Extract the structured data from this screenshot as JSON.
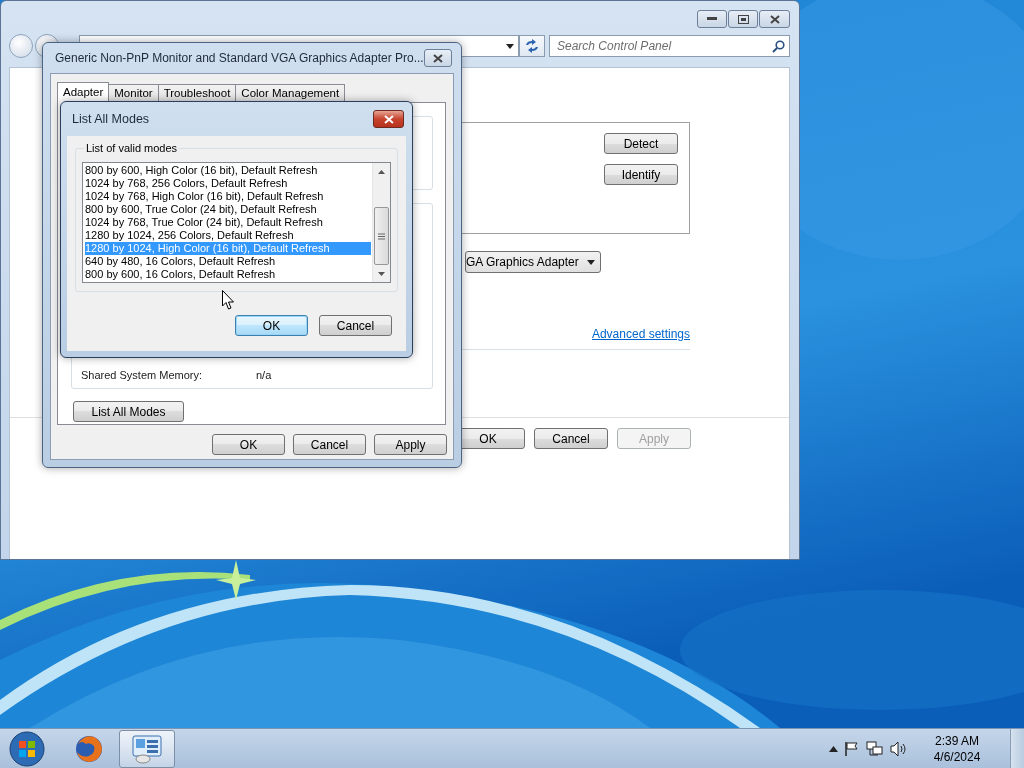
{
  "main_window": {
    "search": {
      "placeholder": "Search Control Panel"
    },
    "side_buttons": [
      {
        "label": "Detect"
      },
      {
        "label": "Identify"
      }
    ],
    "adapter_dropdown": {
      "value": "GA Graphics Adapter"
    },
    "link": "Advanced settings",
    "buttons": [
      {
        "label": "OK",
        "disabled": false
      },
      {
        "label": "Cancel",
        "disabled": false
      },
      {
        "label": "Apply",
        "disabled": true
      }
    ]
  },
  "properties_dialog": {
    "title": "Generic Non-PnP Monitor and Standard VGA Graphics Adapter Pro...",
    "tabs": [
      {
        "label": "Adapter",
        "selected": true
      },
      {
        "label": "Monitor",
        "selected": false
      },
      {
        "label": "Troubleshoot",
        "selected": false
      },
      {
        "label": "Color Management",
        "selected": false
      }
    ],
    "memory": {
      "label": "Shared System Memory:",
      "value": "n/a"
    },
    "list_all_modes_button": "List All Modes",
    "buttons": [
      {
        "label": "OK",
        "disabled": false
      },
      {
        "label": "Cancel",
        "disabled": false
      },
      {
        "label": "Apply",
        "disabled": false
      }
    ]
  },
  "modes_dialog": {
    "title": "List All Modes",
    "group_label": "List of valid modes",
    "modes": [
      {
        "label": "800 by 600, High Color (16 bit), Default Refresh",
        "selected": false
      },
      {
        "label": "1024 by 768, 256 Colors, Default Refresh",
        "selected": false
      },
      {
        "label": "1024 by 768, High Color (16 bit), Default Refresh",
        "selected": false
      },
      {
        "label": "800 by 600, True Color (24 bit), Default Refresh",
        "selected": false
      },
      {
        "label": "1024 by 768, True Color (24 bit), Default Refresh",
        "selected": false
      },
      {
        "label": "1280 by 1024, 256 Colors, Default Refresh",
        "selected": false
      },
      {
        "label": "1280 by 1024, High Color (16 bit), Default Refresh",
        "selected": true
      },
      {
        "label": "640 by 480, 16 Colors, Default Refresh",
        "selected": false
      },
      {
        "label": "800 by 600, 16 Colors, Default Refresh",
        "selected": false
      }
    ],
    "buttons": [
      {
        "label": "OK",
        "default": true
      },
      {
        "label": "Cancel",
        "default": false
      }
    ]
  },
  "taskbar": {
    "apps": [
      {
        "kind": "browser",
        "active": false
      },
      {
        "kind": "control-panel",
        "active": true
      }
    ],
    "clock": {
      "time": "2:39 AM",
      "date": "4/6/2024"
    }
  }
}
